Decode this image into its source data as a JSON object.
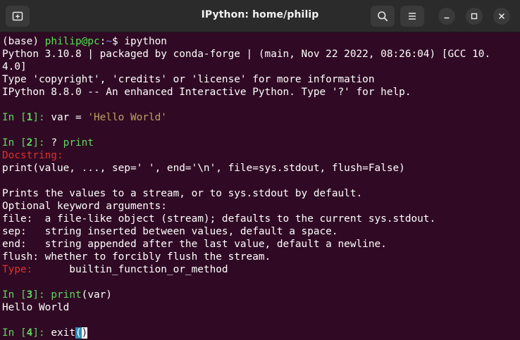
{
  "window": {
    "title": "IPython: home/philip"
  },
  "icons": {
    "new_tab": "new-tab-icon",
    "search": "search-icon",
    "menu": "hamburger-menu-icon",
    "minimize": "minimize-icon",
    "maximize": "maximize-icon",
    "close": "close-icon"
  },
  "colors": {
    "background": "#300a24",
    "titlebar": "#2b2b2b",
    "prompt_green": "#4fe34f",
    "path_blue": "#7e7ef0",
    "docstring_red": "#e0312b",
    "string_gold": "#c0a060"
  },
  "terminal": {
    "shell_prompt": {
      "env": "(base) ",
      "userhost": "philip@pc",
      "colon": ":",
      "path": "~",
      "dollar": "$ ",
      "command": "ipython"
    },
    "banner": [
      "Python 3.10.8 | packaged by conda-forge | (main, Nov 22 2022, 08:26:04) [GCC 10.",
      "4.0]",
      "Type 'copyright', 'credits' or 'license' for more information",
      "IPython 8.8.0 -- An enhanced Interactive Python. Type '?' for help."
    ],
    "in1": {
      "prompt_pre": "In [",
      "num": "1",
      "prompt_post": "]: ",
      "code_pre": "var = ",
      "code_str": "'Hello World'"
    },
    "in2": {
      "prompt_pre": "In [",
      "num": "2",
      "prompt_post": "]: ",
      "code_pre": "? ",
      "code_fn": "print"
    },
    "docstring_label": "Docstring:",
    "signature": "print(value, ..., sep=' ', end='\\n', file=sys.stdout, flush=False)",
    "doc_lines": [
      "Prints the values to a stream, or to sys.stdout by default.",
      "Optional keyword arguments:",
      "file:  a file-like object (stream); defaults to the current sys.stdout.",
      "sep:   string inserted between values, default a space.",
      "end:   string appended after the last value, default a newline.",
      "flush: whether to forcibly flush the stream."
    ],
    "type_label": "Type:",
    "type_value": "      builtin_function_or_method",
    "in3": {
      "prompt_pre": "In [",
      "num": "3",
      "prompt_post": "]: ",
      "code_fn": "print",
      "code_rest": "(var)"
    },
    "output3": "Hello World",
    "in4": {
      "prompt_pre": "In [",
      "num": "4",
      "prompt_post": "]: ",
      "code_pre": "exit",
      "paren_open": "(",
      "paren_close": ")"
    }
  }
}
